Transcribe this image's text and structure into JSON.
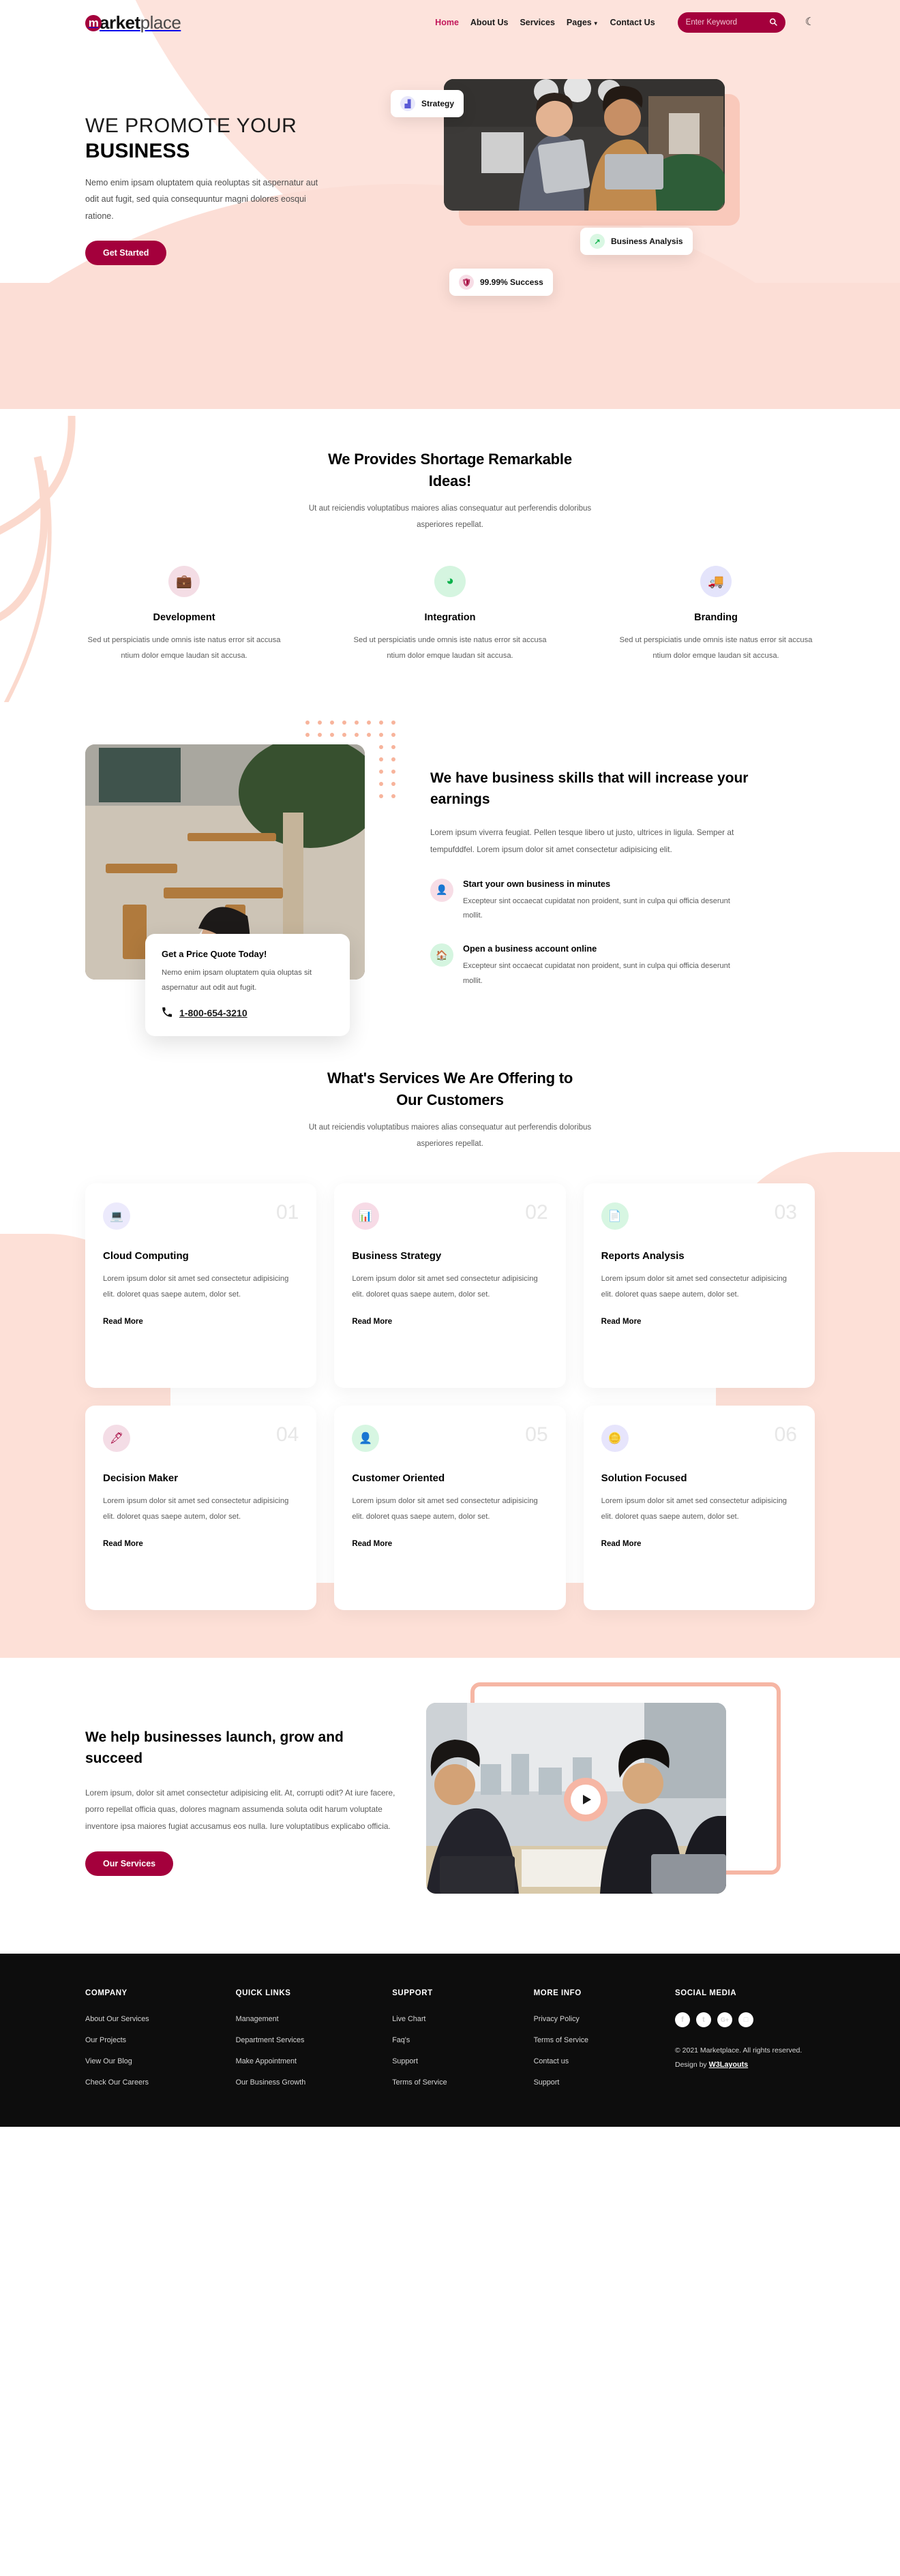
{
  "header": {
    "logo": {
      "badge": "m",
      "bold": "arket",
      "light": "place"
    },
    "nav": [
      {
        "label": "Home",
        "active": true
      },
      {
        "label": "About Us",
        "active": false
      },
      {
        "label": "Services",
        "active": false
      },
      {
        "label": "Pages",
        "active": false,
        "dropdown": true
      },
      {
        "label": "Contact Us",
        "active": false
      }
    ],
    "search": {
      "placeholder": "Enter Keyword",
      "value": "",
      "icon": "search-icon"
    },
    "theme_toggle_icon": "moon-icon"
  },
  "hero": {
    "thin_line": "WE PROMOTE YOUR",
    "bold_line": "BUSINESS",
    "paragraph": "Nemo enim ipsam oluptatem quia reoluptas sit aspernatur aut odit aut fugit, sed quia consequuntur magni dolores eosqui ratione.",
    "cta": "Get Started",
    "badges": [
      {
        "label": "Strategy",
        "icon": "chart-bar-icon",
        "color": "#5b5bd6",
        "bg": "#e8e8fb"
      },
      {
        "label": "Business Analysis",
        "icon": "chart-line-up-icon",
        "color": "#0ab14b",
        "bg": "#d9f7e3"
      },
      {
        "label": "99.99% Success",
        "icon": "shield-icon",
        "color": "#a4003c",
        "bg": "#f7dde6"
      }
    ]
  },
  "ideas": {
    "title_line1": "We Provides Shortage Remarkable",
    "title_line2": "Ideas!",
    "subtitle": "Ut aut reiciendis voluptatibus maiores alias consequatur aut perferendis doloribus asperiores repellat.",
    "features": [
      {
        "title": "Development",
        "icon": "briefcase-clock-icon",
        "color": "#a4003c",
        "bg": "#f4dde5",
        "desc": "Sed ut perspiciatis unde omnis iste natus error sit accusa ntium dolor emque laudan sit accusa."
      },
      {
        "title": "Integration",
        "icon": "pie-chart-icon",
        "color": "#0ab14b",
        "bg": "#d5f5e0",
        "desc": "Sed ut perspiciatis unde omnis iste natus error sit accusa ntium dolor emque laudan sit accusa."
      },
      {
        "title": "Branding",
        "icon": "truck-icon",
        "color": "#4a4ae0",
        "bg": "#e4e4fb",
        "desc": "Sed ut perspiciatis unde omnis iste natus error sit accusa ntium dolor emque laudan sit accusa."
      }
    ]
  },
  "skills": {
    "heading": "We have business skills that will increase your earnings",
    "paragraph": "Lorem ipsum viverra feugiat. Pellen tesque libero ut justo, ultrices in ligula. Semper at tempufddfel. Lorem ipsum dolor sit amet consectetur adipisicing elit.",
    "items": [
      {
        "title": "Start your own business in minutes",
        "icon": "user-clock-icon",
        "color": "#a4003c",
        "bg": "#f7dde6",
        "desc": "Excepteur sint occaecat cupidatat non proident, sunt in culpa qui officia deserunt mollit."
      },
      {
        "title": "Open a business account online",
        "icon": "house-laptop-icon",
        "color": "#0ab14b",
        "bg": "#d5f5e0",
        "desc": "Excepteur sint occaecat cupidatat non proident, sunt in culpa qui officia deserunt mollit."
      }
    ],
    "quote_card": {
      "title": "Get a Price Quote Today!",
      "paragraph": "Nemo enim ipsam oluptatem quia oluptas sit aspernatur aut odit aut fugit.",
      "phone": "1-800-654-3210",
      "phone_icon": "phone-icon"
    }
  },
  "services": {
    "title_line1": "What's Services We Are Offering to",
    "title_line2": "Our Customers",
    "subtitle": "Ut aut reiciendis voluptatibus maiores alias consequatur aut perferendis doloribus asperiores repellat.",
    "read_more": "Read More",
    "cards": [
      {
        "number": "01",
        "title": "Cloud Computing",
        "icon": "laptop-code-icon",
        "color": "#4a4ae0",
        "bg": "#eceafc",
        "desc": "Lorem ipsum dolor sit amet sed consectetur adipisicing elit. doloret quas saepe autem, dolor set."
      },
      {
        "number": "02",
        "title": "Business Strategy",
        "icon": "chart-bar-icon",
        "color": "#c2185b",
        "bg": "#f7dbe6",
        "desc": "Lorem ipsum dolor sit amet sed consectetur adipisicing elit. doloret quas saepe autem, dolor set."
      },
      {
        "number": "03",
        "title": "Reports Analysis",
        "icon": "copy-files-icon",
        "color": "#0ab14b",
        "bg": "#d7f6e2",
        "desc": "Lorem ipsum dolor sit amet sed consectetur adipisicing elit. doloret quas saepe autem, dolor set."
      },
      {
        "number": "04",
        "title": "Decision Maker",
        "icon": "pen-nib-icon",
        "color": "#a4003c",
        "bg": "#f4dde6",
        "desc": "Lorem ipsum dolor sit amet sed consectetur adipisicing elit. doloret quas saepe autem, dolor set."
      },
      {
        "number": "05",
        "title": "Customer Oriented",
        "icon": "user-gear-icon",
        "color": "#0ab14b",
        "bg": "#d7f6e2",
        "desc": "Lorem ipsum dolor sit amet sed consectetur adipisicing elit. doloret quas saepe autem, dolor set."
      },
      {
        "number": "06",
        "title": "Solution Focused",
        "icon": "coins-icon",
        "color": "#4a4ae0",
        "bg": "#e7e5fc",
        "desc": "Lorem ipsum dolor sit amet sed consectetur adipisicing elit. doloret quas saepe autem, dolor set."
      }
    ]
  },
  "launch": {
    "heading": "We help businesses launch, grow and succeed",
    "paragraph": "Lorem ipsum, dolor sit amet consectetur adipisicing elit. At, corrupti odit? At iure facere, porro repellat officia quas, dolores magnam assumenda soluta odit harum voluptate inventore ipsa maiores fugiat accusamus eos nulla. Iure voluptatibus explicabo officia.",
    "cta": "Our Services",
    "play_icon": "play-icon"
  },
  "footer": {
    "columns": [
      {
        "heading": "COMPANY",
        "links": [
          "About Our Services",
          "Our Projects",
          "View Our Blog",
          "Check Our Careers"
        ]
      },
      {
        "heading": "QUICK LINKS",
        "links": [
          "Management",
          "Department Services",
          "Make Appointment",
          "Our Business Growth"
        ]
      },
      {
        "heading": "SUPPORT",
        "links": [
          "Live Chart",
          "Faq's",
          "Support",
          "Terms of Service"
        ]
      },
      {
        "heading": "MORE INFO",
        "links": [
          "Privacy Policy",
          "Terms of Service",
          "Contact us",
          "Support"
        ]
      }
    ],
    "social": {
      "heading": "SOCIAL MEDIA",
      "icons": [
        {
          "name": "facebook-icon",
          "glyph": "f"
        },
        {
          "name": "twitter-icon",
          "glyph": "t"
        },
        {
          "name": "google-plus-icon",
          "glyph": "G+"
        },
        {
          "name": "instagram-icon",
          "glyph": "□"
        }
      ]
    },
    "copyright_pre": "© 2021 Marketplace. All rights reserved. Design by ",
    "copyright_link": "W3Layouts"
  },
  "colors": {
    "brand": "#a4003c",
    "accent_pink": "#f6b6a4",
    "soft_bg": "#fcded6",
    "footer_bg": "#0d0d0d"
  }
}
